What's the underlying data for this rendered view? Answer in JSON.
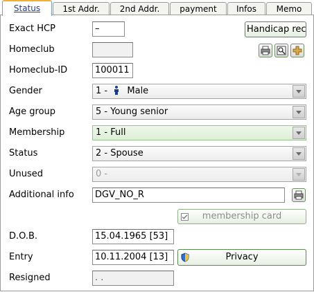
{
  "tabs": [
    {
      "label": "Status"
    },
    {
      "label": "1st Addr."
    },
    {
      "label": "2nd Addr."
    },
    {
      "label": "payment"
    },
    {
      "label": "Infos"
    },
    {
      "label": "Memo"
    }
  ],
  "exact_hcp": {
    "label": "Exact HCP",
    "value": "–"
  },
  "handicap_button": {
    "label": "Handicap reco"
  },
  "homeclub": {
    "label": "Homeclub",
    "value": ""
  },
  "homeclub_id": {
    "label": "Homeclub-ID",
    "value": "100011"
  },
  "gender": {
    "label": "Gender",
    "prefix": "1 -",
    "value": "Male"
  },
  "age_group": {
    "label": "Age group",
    "value": "5 - Young senior"
  },
  "membership": {
    "label": "Membership",
    "value": "1 - Full"
  },
  "status": {
    "label": "Status",
    "value": "2 - Spouse"
  },
  "unused": {
    "label": "Unused",
    "value": "0 -"
  },
  "additional_info": {
    "label": "Additional info",
    "value": "DGV_NO_R"
  },
  "membership_card": {
    "label": "membership card",
    "checked": true
  },
  "dob": {
    "label": "D.O.B.",
    "value": "15.04.1965  [53]"
  },
  "entry": {
    "label": "Entry",
    "value": "10.11.2004  [13]"
  },
  "privacy_button": {
    "label": "Privacy"
  },
  "resigned": {
    "label": "Resigned",
    "value": " . ."
  },
  "icons": [
    "printer-icon",
    "preview-icon",
    "plus-icon",
    "person-icon",
    "privacy-shield-icon",
    "checkbox-icon"
  ],
  "colors": {
    "active_tab_text": "#1b3bb8",
    "active_tab_accent": "#f0b035",
    "membership_combo": "#dcefd6",
    "button_border": "#5a8a50"
  }
}
